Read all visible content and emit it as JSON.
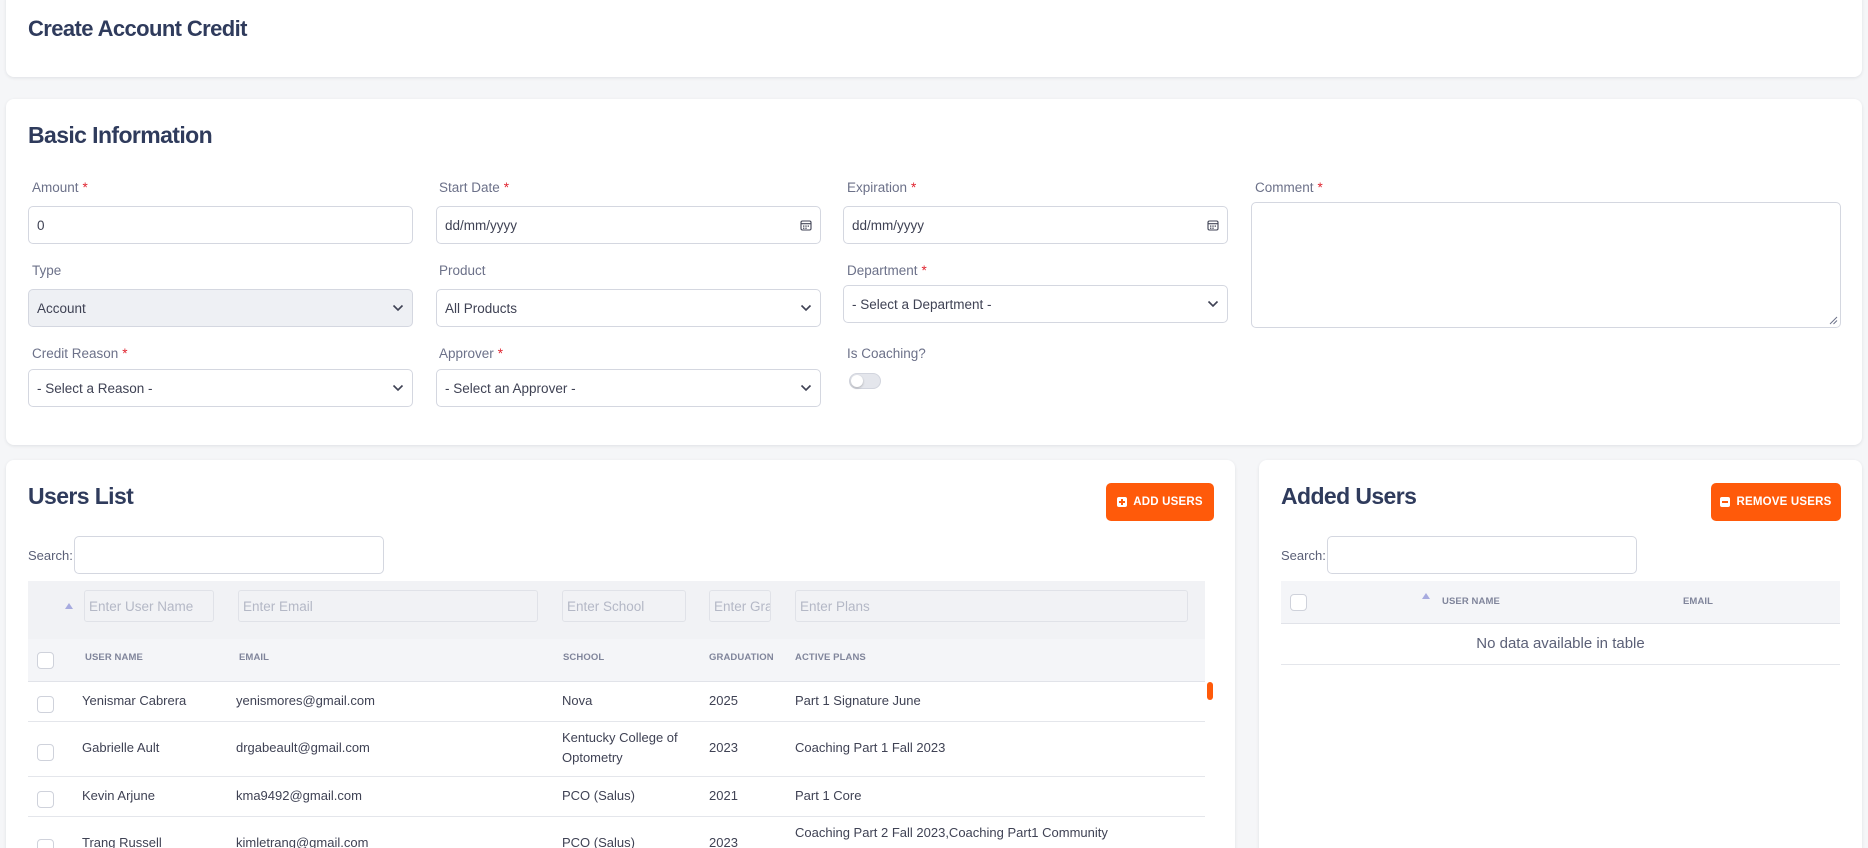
{
  "header": {
    "title": "Create Account Credit"
  },
  "basic_info": {
    "title": "Basic Information",
    "amount": {
      "label": "Amount",
      "required": "*",
      "value": "0"
    },
    "start_date": {
      "label": "Start Date",
      "required": "*",
      "value": "dd/mm/yyyy"
    },
    "expiration": {
      "label": "Expiration",
      "required": "*",
      "value": "dd/mm/yyyy"
    },
    "comment": {
      "label": "Comment",
      "required": "*",
      "value": ""
    },
    "type": {
      "label": "Type",
      "value": "Account"
    },
    "product": {
      "label": "Product",
      "value": "All Products"
    },
    "department": {
      "label": "Department",
      "required": "*",
      "value": "- Select a Department -"
    },
    "credit_reason": {
      "label": "Credit Reason",
      "required": "*",
      "value": "- Select a Reason -"
    },
    "approver": {
      "label": "Approver",
      "required": "*",
      "value": "- Select an Approver -"
    },
    "is_coaching": {
      "label": "Is Coaching?",
      "checked": false
    }
  },
  "users_list": {
    "title": "Users List",
    "add_button": "ADD USERS",
    "search_label": "Search:",
    "filters": {
      "user_name": "Enter User Name",
      "email": "Enter Email",
      "school": "Enter School",
      "grad": "Enter Grad",
      "plans": "Enter Plans"
    },
    "columns": [
      "USER NAME",
      "EMAIL",
      "SCHOOL",
      "GRADUATION",
      "ACTIVE PLANS"
    ],
    "rows": [
      {
        "name": "Yenismar Cabrera",
        "email": "yenismores@gmail.com",
        "school": "Nova",
        "school2": "",
        "grad": "2025",
        "plans": "Part 1 Signature June",
        "plans2": ""
      },
      {
        "name": "Gabrielle Ault",
        "email": "drgabeault@gmail.com",
        "school": "Kentucky College of",
        "school2": "Optometry",
        "grad": "2023",
        "plans": "Coaching Part 1 Fall 2023",
        "plans2": ""
      },
      {
        "name": "Kevin Arjune",
        "email": "kma9492@gmail.com",
        "school": "PCO (Salus)",
        "school2": "",
        "grad": "2021",
        "plans": "Part 1 Core",
        "plans2": ""
      },
      {
        "name": "Trang Russell",
        "email": "kimletrang@gmail.com",
        "school": "PCO (Salus)",
        "school2": "",
        "grad": "2023",
        "plans": "Coaching Part 2 Fall 2023,Coaching Part1 Community",
        "plans2": ""
      }
    ]
  },
  "added_users": {
    "title": "Added Users",
    "remove_button": "REMOVE USERS",
    "search_label": "Search:",
    "columns": [
      "USER NAME",
      "EMAIL"
    ],
    "empty_message": "No data available in table"
  },
  "colors": {
    "accent": "#ff5a0a",
    "title": "#2f3b5c",
    "required": "#e0242f",
    "background": "#f5f6f8"
  }
}
